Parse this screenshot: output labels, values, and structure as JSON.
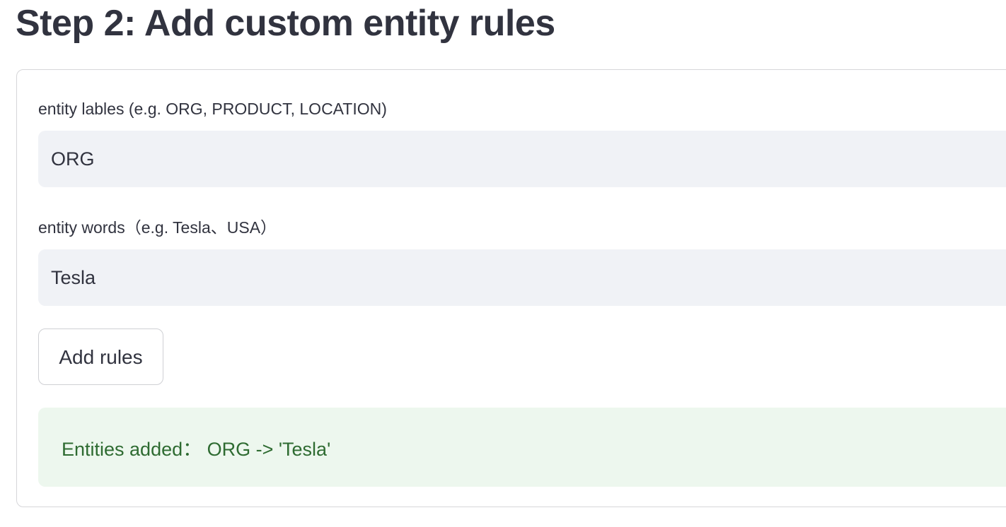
{
  "page": {
    "title": "Step 2: Add custom entity rules"
  },
  "form": {
    "labels_field": {
      "label": "entity lables (e.g. ORG, PRODUCT, LOCATION)",
      "value": "ORG"
    },
    "words_field": {
      "label": "entity words（e.g. Tesla、USA）",
      "value": "Tesla"
    },
    "add_button_label": "Add rules"
  },
  "alert": {
    "message": "Entities added： ORG -> 'Tesla'"
  },
  "colors": {
    "text": "#31333f",
    "input_background": "#f0f2f6",
    "card_border": "#d6d6d9",
    "success_background": "#edf7ee",
    "success_text": "#2e6b31"
  }
}
